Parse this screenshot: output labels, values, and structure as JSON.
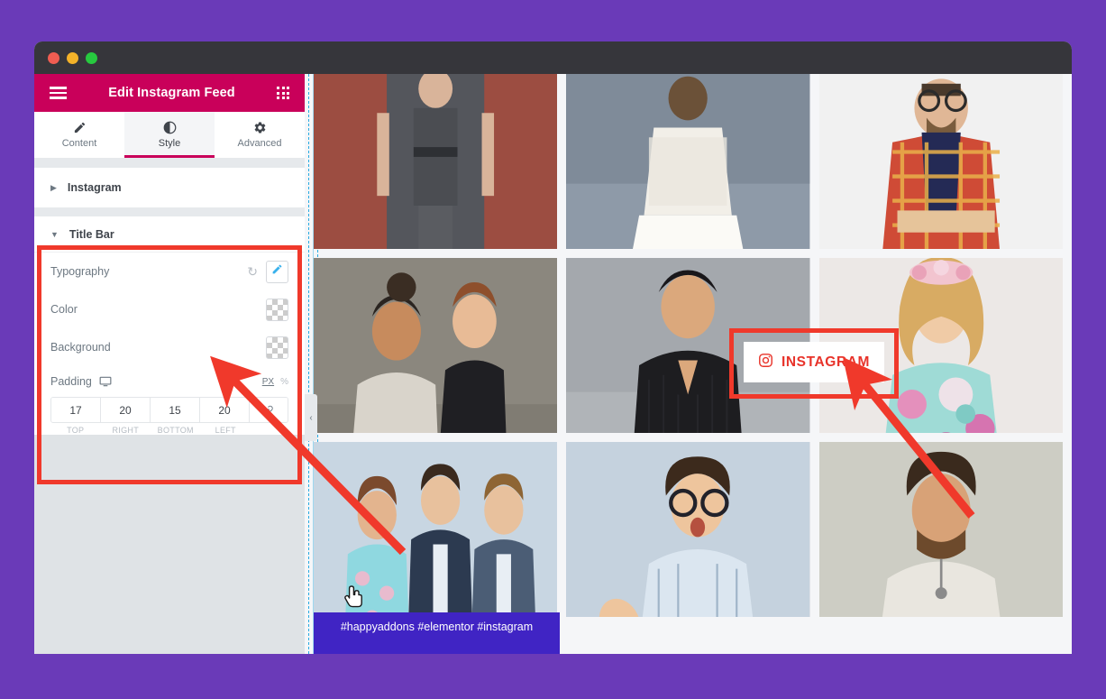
{
  "window": {
    "traffic_lights": [
      "close",
      "minimize",
      "maximize"
    ]
  },
  "panel": {
    "header": {
      "title": "Edit Instagram Feed",
      "menu_icon": "hamburger-icon",
      "apps_icon": "apps-grid-icon"
    },
    "tabs": [
      {
        "label": "Content",
        "icon": "pencil-icon",
        "active": false
      },
      {
        "label": "Style",
        "icon": "contrast-icon",
        "active": true
      },
      {
        "label": "Advanced",
        "icon": "gear-icon",
        "active": false
      }
    ],
    "sections": [
      {
        "label": "Instagram",
        "expanded": false
      }
    ],
    "title_bar_section": {
      "label": "Title Bar",
      "expanded": true,
      "controls": [
        {
          "name": "Typography",
          "type": "typography",
          "reset_icon": "reset-icon",
          "edit_icon": "pencil-icon"
        },
        {
          "name": "Color",
          "type": "color",
          "value": "transparent"
        },
        {
          "name": "Background",
          "type": "color",
          "value": "transparent"
        }
      ],
      "padding": {
        "label": "Padding",
        "device_icon": "desktop-icon",
        "units": [
          {
            "label": "PX",
            "selected": true
          },
          {
            "label": "%",
            "selected": false
          }
        ],
        "values": [
          {
            "value": "17",
            "label": "TOP"
          },
          {
            "value": "20",
            "label": "RIGHT"
          },
          {
            "value": "15",
            "label": "BOTTOM"
          },
          {
            "value": "20",
            "label": "LEFT"
          }
        ],
        "link_icon": "link-icon"
      }
    },
    "collapse_handle": {
      "icon": "chevron-left-icon",
      "label": "‹"
    }
  },
  "canvas": {
    "instagram_button": {
      "label": "INSTAGRAM",
      "icon": "instagram-icon",
      "text_color": "#e8332a"
    },
    "caption": "#happyaddons #elementor #instagram",
    "grid": {
      "columns": 3,
      "items": [
        {
          "alt": "woman in grey dress against red brick wall",
          "bg": "#b0564a"
        },
        {
          "alt": "bride in white lace gown, back view",
          "bg": "#8a95a3"
        },
        {
          "alt": "bearded man with glasses in plaid shirt",
          "bg": "#efefef"
        },
        {
          "alt": "two women working together at laptop",
          "bg": "#7e7a72"
        },
        {
          "alt": "man in black sweater",
          "bg": "#a8acb0"
        },
        {
          "alt": "blonde woman in floral dress with flower crown",
          "bg": "#e9e6e6"
        },
        {
          "alt": "business team looking at laptop",
          "bg": "#cdd8e3"
        },
        {
          "alt": "woman with glasses gesturing",
          "bg": "#c8d3dd"
        },
        {
          "alt": "man with beard in white shirt",
          "bg": "#cfcfc7"
        }
      ]
    }
  },
  "annotations": {
    "highlight_color": "#f0392b",
    "arrows": [
      {
        "from": "instagram-feed-grid",
        "to": "title-bar-settings-panel"
      },
      {
        "from": "floral-dress-photo",
        "to": "instagram-title-bar-button"
      }
    ],
    "cursor": "pointer-hand-cursor"
  },
  "colors": {
    "page_background": "#6a3ab8",
    "panel_header": "#c9005a",
    "caption_background": "#4024c4",
    "accent_red": "#f0392b"
  }
}
